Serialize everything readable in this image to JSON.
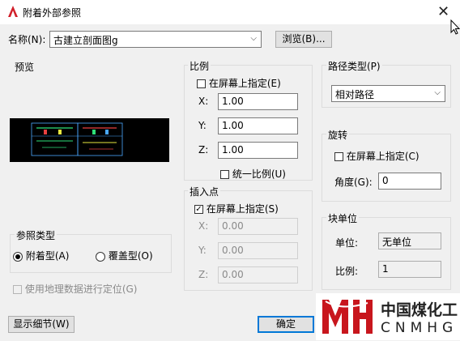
{
  "window": {
    "title": "附着外部参照",
    "close_glyph": "✕"
  },
  "name_row": {
    "label": "名称(N):",
    "value": "古建立剖面图g",
    "browse_label": "浏览(B)..."
  },
  "preview": {
    "label": "预览"
  },
  "scale": {
    "label": "比例",
    "specify_on_screen": "在屏幕上指定(E)",
    "specify_checked": false,
    "x_label": "X:",
    "x_value": "1.00",
    "y_label": "Y:",
    "y_value": "1.00",
    "z_label": "Z:",
    "z_value": "1.00",
    "uniform_label": "统一比例(U)",
    "uniform_checked": false
  },
  "insertion_point": {
    "label": "插入点",
    "specify_on_screen": "在屏幕上指定(S)",
    "specify_checked": true,
    "x_label": "X:",
    "x_value": "0.00",
    "y_label": "Y:",
    "y_value": "0.00",
    "z_label": "Z:",
    "z_value": "0.00"
  },
  "path_type": {
    "label": "路径类型(P)",
    "value": "相对路径"
  },
  "rotation": {
    "label": "旋转",
    "specify_on_screen": "在屏幕上指定(C)",
    "specify_checked": false,
    "angle_label": "角度(G):",
    "angle_value": "0"
  },
  "block_unit": {
    "label": "块单位",
    "unit_label": "单位:",
    "unit_value": "无单位",
    "scale_label": "比例:",
    "scale_value": "1"
  },
  "reference_type": {
    "label": "参照类型",
    "attachment_label": "附着型(A)",
    "overlay_label": "覆盖型(O)",
    "selected": "attachment"
  },
  "geo_location": {
    "label": "使用地理数据进行定位(G)",
    "enabled": false
  },
  "buttons": {
    "show_details": "显示细节(W)",
    "ok": "确定"
  },
  "watermark": {
    "cn": "中国煤化工",
    "en": "CNMHG"
  },
  "colors": {
    "brand_red": "#c8161d",
    "accent_blue": "#0078d7"
  }
}
